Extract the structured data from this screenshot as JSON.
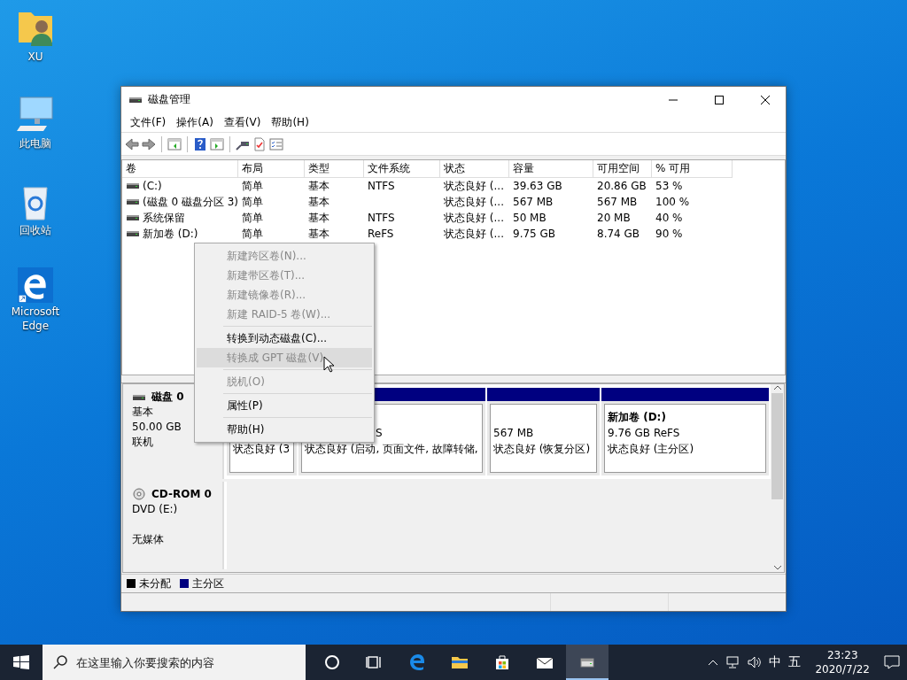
{
  "desktop_icons": [
    {
      "label": "XU",
      "kind": "user-folder"
    },
    {
      "label": "此电脑",
      "kind": "computer"
    },
    {
      "label": "回收站",
      "kind": "recycle-bin"
    },
    {
      "label": "Microsoft Edge",
      "kind": "edge"
    }
  ],
  "window": {
    "title": "磁盘管理",
    "menu": [
      "文件(F)",
      "操作(A)",
      "查看(V)",
      "帮助(H)"
    ]
  },
  "volume_table": {
    "columns": [
      "卷",
      "布局",
      "类型",
      "文件系统",
      "状态",
      "容量",
      "可用空间",
      "% 可用"
    ],
    "rows": [
      [
        "(C:)",
        "简单",
        "基本",
        "NTFS",
        "状态良好 (...",
        "39.63 GB",
        "20.86 GB",
        "53 %"
      ],
      [
        "(磁盘 0 磁盘分区 3)",
        "简单",
        "基本",
        "",
        "状态良好 (...",
        "567 MB",
        "567 MB",
        "100 %"
      ],
      [
        "系统保留",
        "简单",
        "基本",
        "NTFS",
        "状态良好 (...",
        "50 MB",
        "20 MB",
        "40 %"
      ],
      [
        "新加卷 (D:)",
        "简单",
        "基本",
        "ReFS",
        "状态良好 (...",
        "9.75 GB",
        "8.74 GB",
        "90 %"
      ]
    ]
  },
  "disks": [
    {
      "name": "磁盘 0",
      "kind": "disk",
      "lines": [
        "基本",
        "50.00 GB",
        "联机"
      ],
      "partitions": [
        {
          "status": "状态良好 (3"
        },
        {
          "size": "S",
          "status": "状态良好 (启动, 页面文件, 故障转储,"
        },
        {
          "size": "567 MB",
          "status": "状态良好 (恢复分区)"
        },
        {
          "title": "新加卷  (D:)",
          "size": "9.76 GB ReFS",
          "status": "状态良好 (主分区)"
        }
      ]
    },
    {
      "name": "CD-ROM 0",
      "kind": "cdrom",
      "lines": [
        "DVD (E:)"
      ],
      "media": "无媒体"
    }
  ],
  "legend": [
    {
      "label": "未分配",
      "color": "#000000"
    },
    {
      "label": "主分区",
      "color": "#000080"
    }
  ],
  "context_menu": [
    {
      "kind": "item",
      "label": "新建跨区卷(N)...",
      "disabled": true,
      "selected": false
    },
    {
      "kind": "item",
      "label": "新建带区卷(T)...",
      "disabled": true,
      "selected": false
    },
    {
      "kind": "item",
      "label": "新建镜像卷(R)...",
      "disabled": true,
      "selected": false
    },
    {
      "kind": "item",
      "label": "新建 RAID-5 卷(W)...",
      "disabled": true,
      "selected": false
    },
    {
      "kind": "separator"
    },
    {
      "kind": "item",
      "label": "转换到动态磁盘(C)...",
      "disabled": false,
      "selected": false
    },
    {
      "kind": "item",
      "label": "转换成 GPT 磁盘(V)",
      "disabled": true,
      "selected": true
    },
    {
      "kind": "separator"
    },
    {
      "kind": "item",
      "label": "脱机(O)",
      "disabled": true,
      "selected": false
    },
    {
      "kind": "separator"
    },
    {
      "kind": "item",
      "label": "属性(P)",
      "disabled": false,
      "selected": false
    },
    {
      "kind": "separator"
    },
    {
      "kind": "item",
      "label": "帮助(H)",
      "disabled": false,
      "selected": false
    }
  ],
  "taskbar": {
    "search": {
      "placeholder": "在这里输入你要搜索的内容"
    },
    "apps": [
      {
        "kind": "cortana",
        "active": false
      },
      {
        "kind": "task-view",
        "active": false
      },
      {
        "kind": "edge",
        "active": false
      },
      {
        "kind": "folder",
        "active": false
      },
      {
        "kind": "store",
        "active": false
      },
      {
        "kind": "mail",
        "active": false
      },
      {
        "kind": "disk",
        "active": true
      }
    ],
    "ime": [
      "中",
      "五"
    ],
    "time": "23:23",
    "date": "2020/7/22"
  }
}
